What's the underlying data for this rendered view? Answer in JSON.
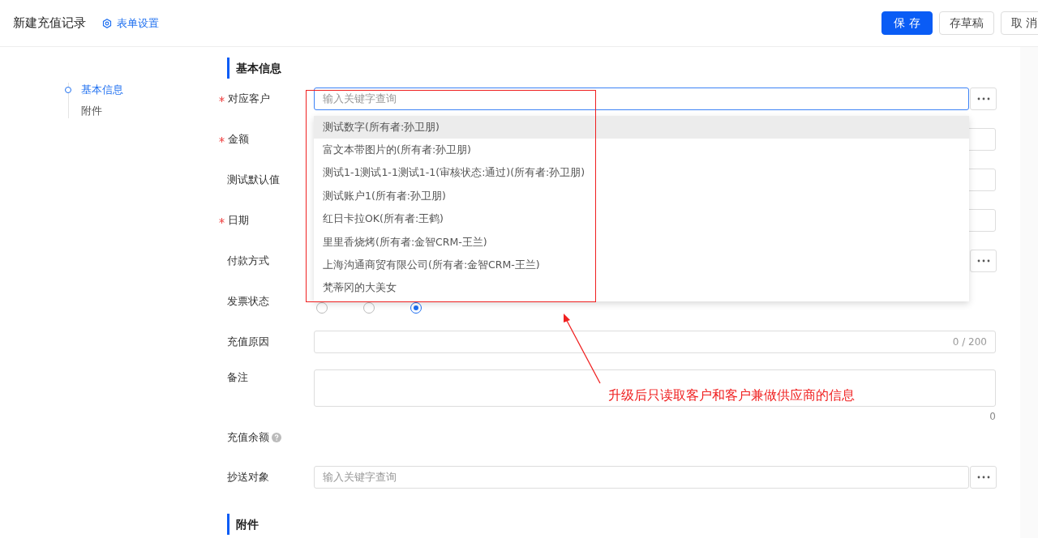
{
  "header": {
    "title": "新建充值记录",
    "settings_link": "表单设置",
    "buttons": [
      {
        "label": "保 存",
        "kind": "primary"
      },
      {
        "label": "存草稿",
        "kind": "default"
      },
      {
        "label": "取 消",
        "kind": "default"
      }
    ]
  },
  "nav": {
    "items": [
      {
        "label": "基本信息",
        "selected": true
      },
      {
        "label": "附件",
        "selected": false
      }
    ]
  },
  "sections": [
    {
      "title": "基本信息"
    },
    {
      "title": "附件"
    }
  ],
  "fields": [
    {
      "label": "对应客户",
      "required": true,
      "kind": "lookup",
      "placeholder": "输入关键字查询",
      "focused": true
    },
    {
      "label": "金额",
      "required": true,
      "kind": "input"
    },
    {
      "label": "测试默认值",
      "required": false,
      "kind": "input"
    },
    {
      "label": "日期",
      "required": true,
      "kind": "input"
    },
    {
      "label": "付款方式",
      "required": false,
      "kind": "lookup"
    },
    {
      "label": "发票状态",
      "required": false,
      "kind": "radio",
      "options": [
        {
          "selected": false
        },
        {
          "selected": false
        },
        {
          "selected": true
        }
      ]
    },
    {
      "label": "充值原因",
      "required": false,
      "kind": "counter",
      "counter": "0 / 200"
    },
    {
      "label": "备注",
      "required": false,
      "kind": "textarea",
      "counter": "0"
    },
    {
      "label": "充值余额",
      "required": false,
      "kind": "info"
    },
    {
      "label": "抄送对象",
      "required": false,
      "kind": "lookup",
      "placeholder": "输入关键字查询",
      "focused": false
    }
  ],
  "dropdown": {
    "options": [
      {
        "label": "测试数字(所有者:孙卫朋)",
        "selected": true
      },
      {
        "label": "富文本带图片的(所有者:孙卫朋)",
        "selected": false
      },
      {
        "label": "测试1-1测试1-1测试1-1(审核状态:通过)(所有者:孙卫朋)",
        "selected": false
      },
      {
        "label": "测试账户1(所有者:孙卫朋)",
        "selected": false
      },
      {
        "label": "红日卡拉OK(所有者:王鹤)",
        "selected": false
      },
      {
        "label": "里里香烧烤(所有者:金智CRM-王兰)",
        "selected": false
      },
      {
        "label": "上海沟通商贸有限公司(所有者:金智CRM-王兰)",
        "selected": false
      },
      {
        "label": "梵蒂冈的大美女",
        "selected": false
      }
    ]
  },
  "annotation": {
    "text": "升级后只读取客户和客户兼做供应商的信息"
  }
}
